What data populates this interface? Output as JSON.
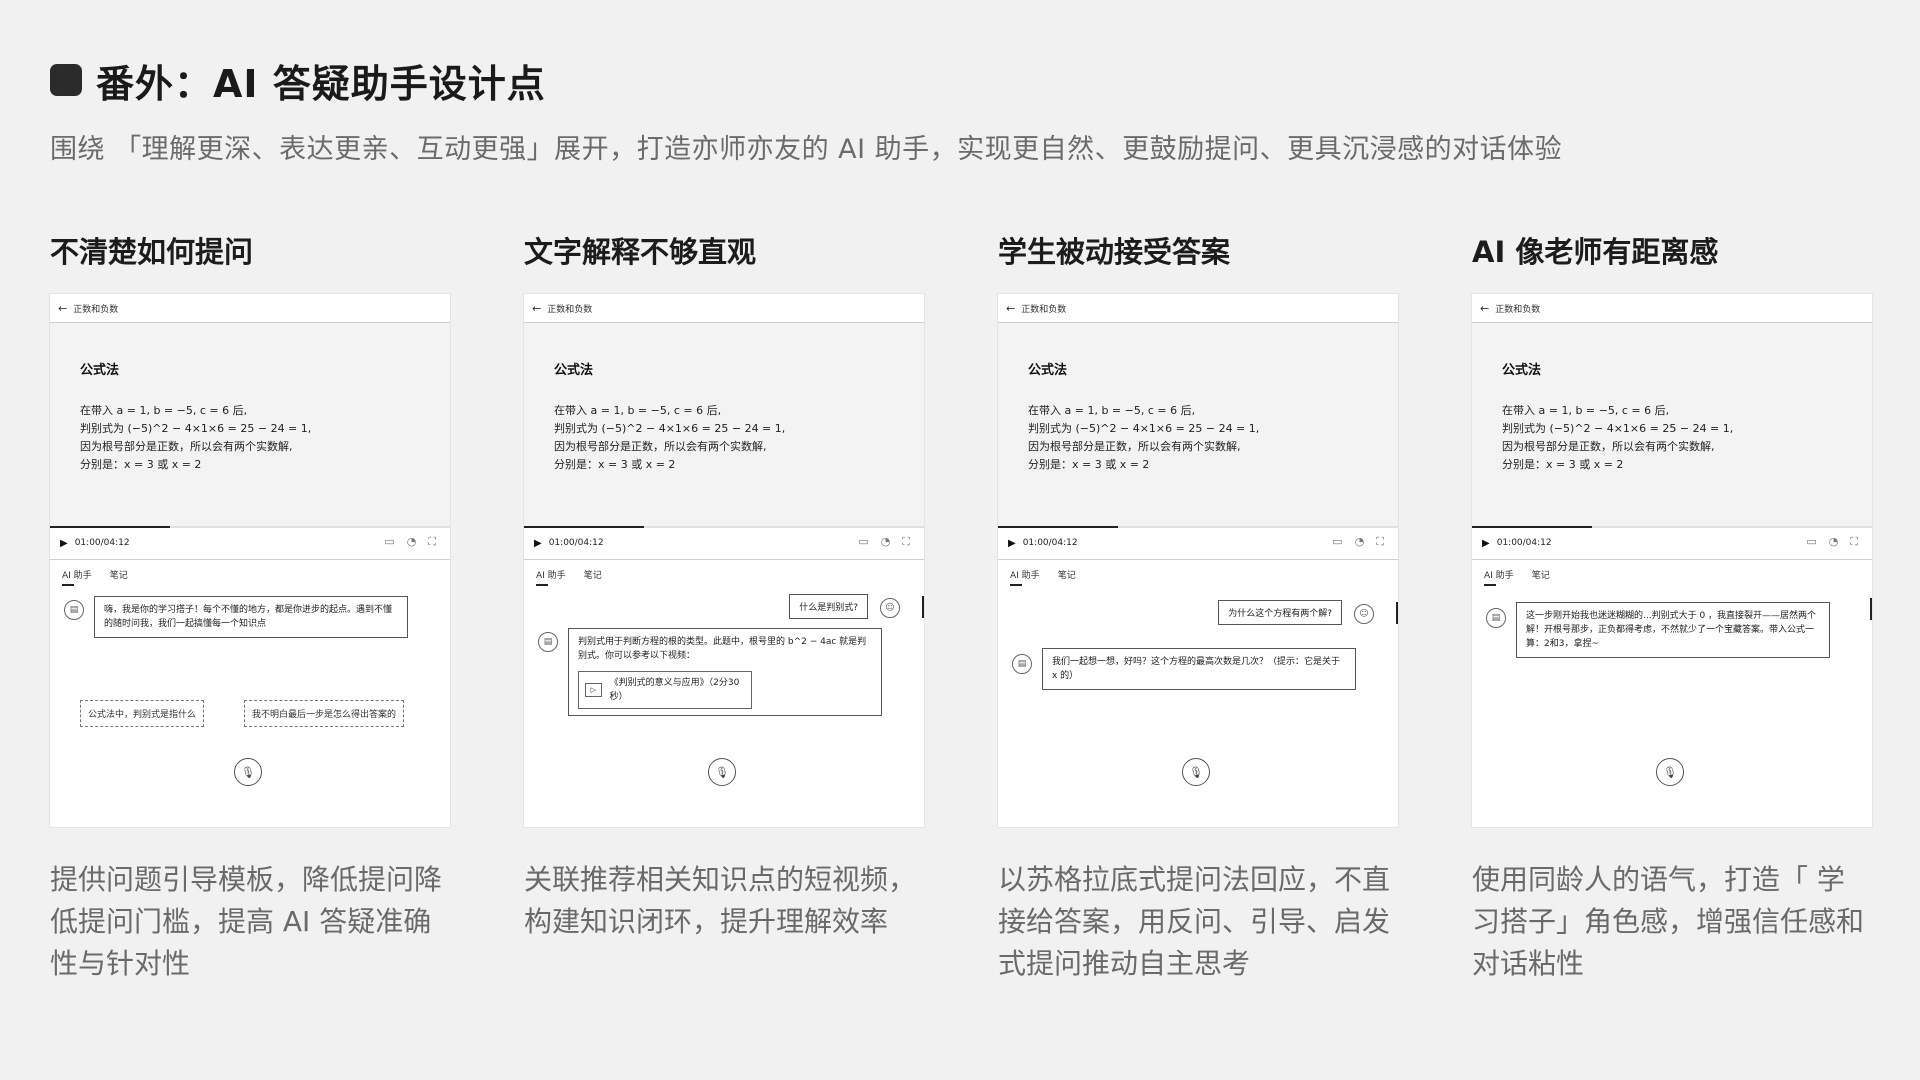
{
  "header": {
    "title": "番外：AI 答疑助手设计点",
    "subtitle": "围绕 「理解更深、表达更亲、互动更强」展开，打造亦师亦友的 AI 助手，实现更自然、更鼓励提问、更具沉浸感的对话体验"
  },
  "mock_common": {
    "topbar_title": "正数和负数",
    "formula_title": "公式法",
    "formula_lines": [
      "在带入 a = 1, b = −5, c = 6 后,",
      "判别式为 (−5)^2 − 4×1×6 = 25 − 24 = 1,",
      "因为根号部分是正数，所以会有两个实数解,",
      "分别是：x = 3  或  x = 2"
    ],
    "time": "01:00/04:12",
    "progress_fraction": 0.3,
    "tab_ai": "AI 助手",
    "tab_notes": "笔记"
  },
  "columns": [
    {
      "heading": "不清楚如何提问",
      "bot_message": "嗨，我是你的学习搭子！每个不懂的地方，都是你进步的起点。遇到不懂的随时问我，我们一起搞懂每一个知识点",
      "suggestion_1": "公式法中，判别式是指什么",
      "suggestion_2": "我不明白最后一步是怎么得出答案的",
      "description": "提供问题引导模板，降低提问降低提问门槛，提高 AI 答疑准确性与针对性"
    },
    {
      "heading": "文字解释不够直观",
      "user_message": "什么是判别式?",
      "bot_message": "判别式用于判断方程的根的类型。此题中，根号里的 b^2 − 4ac 就是判别式。你可以参考以下视频：",
      "video_title": "《判别式的意义与应用》（2分30秒）",
      "description": "关联推荐相关知识点的短视频，构建知识闭环，提升理解效率"
    },
    {
      "heading": "学生被动接受答案",
      "user_message": "为什么这个方程有两个解?",
      "bot_message": "我们一起想一想，好吗？这个方程的最高次数是几次？（提示：它是关于 x 的）",
      "description": "以苏格拉底式提问法回应，不直接给答案，用反问、引导、启发式提问推动自主思考"
    },
    {
      "heading": "AI 像老师有距离感",
      "bot_message": "这一步刚开始我也迷迷糊糊的...判别式大于 0 ，我直接裂开——居然两个解！开根号那步，正负都得考虑，不然就少了一个宝藏答案。带入公式一算：2和3，拿捏~",
      "description": "使用同龄人的语气，打造「 学习搭子」角色感，增强信任感和对话粘性"
    }
  ]
}
